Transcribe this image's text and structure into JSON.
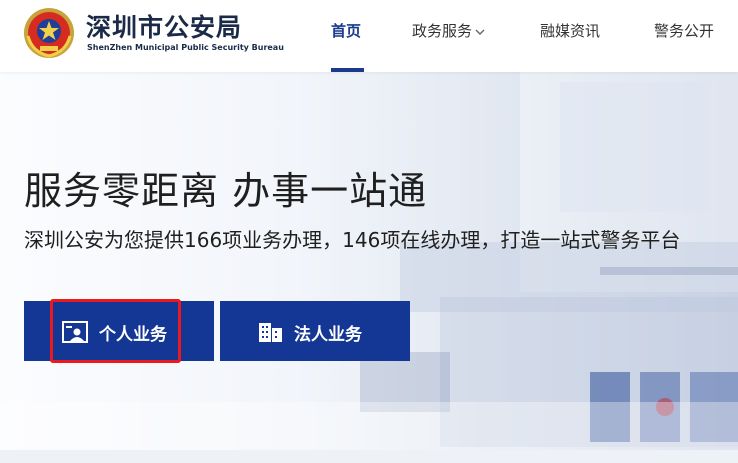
{
  "header": {
    "title": "深圳市公安局",
    "subtitle": "ShenZhen Municipal Public Security Bureau",
    "logo_icon": "police-emblem-icon",
    "nav": [
      {
        "label": "首页",
        "active": true
      },
      {
        "label": "政务服务",
        "has_dropdown": true
      },
      {
        "label": "融媒资讯"
      },
      {
        "label": "警务公开"
      }
    ]
  },
  "hero": {
    "title": "服务零距离 办事一站通",
    "description": "深圳公安为您提供166项业务办理，146项在线办理，打造一站式警务平台",
    "buttons": [
      {
        "label": "个人业务",
        "icon": "person-card-icon"
      },
      {
        "label": "法人业务",
        "icon": "building-icon"
      }
    ]
  },
  "colors": {
    "primary": "#143796",
    "nav_active": "#1a3a8c",
    "highlight": "#e8191f"
  }
}
